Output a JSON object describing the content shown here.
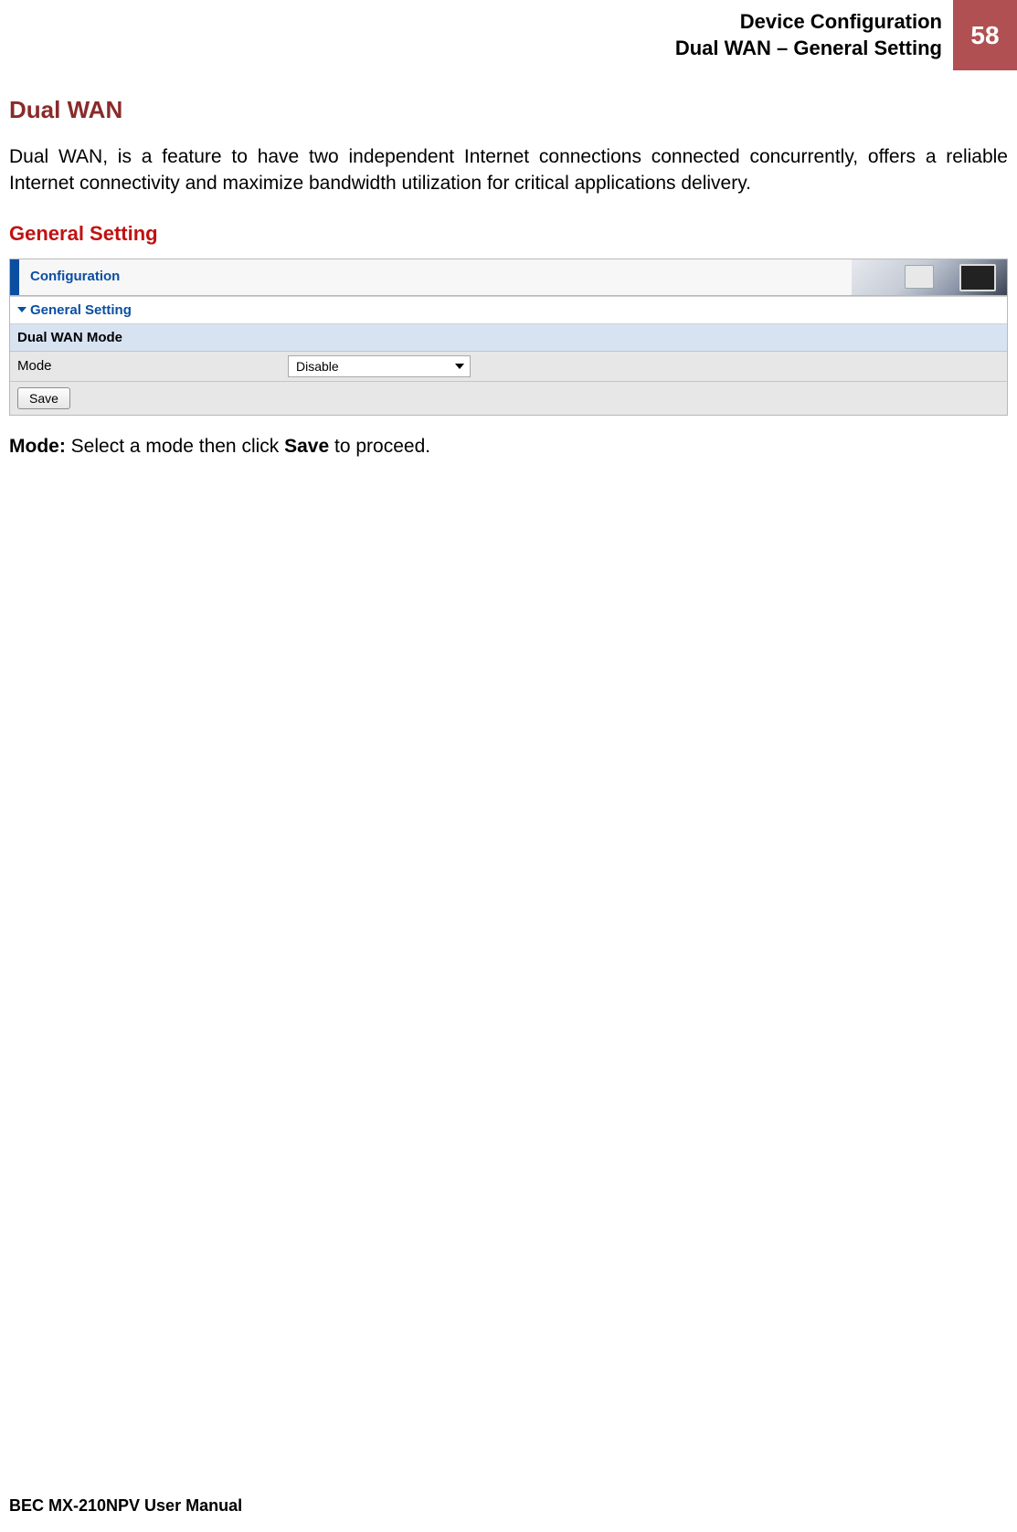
{
  "header": {
    "title_line1": "Device Configuration",
    "title_line2": "Dual WAN – General Setting",
    "page_number": "58"
  },
  "section": {
    "title": "Dual WAN",
    "intro": "Dual WAN, is a feature to have two independent Internet connections connected concurrently, offers a reliable Internet connectivity and maximize bandwidth utilization for critical applications delivery.",
    "subsection_title": "General Setting"
  },
  "panel": {
    "title": "Configuration",
    "section_header": "General Setting",
    "dual_wan_mode_label": "Dual WAN Mode",
    "mode_label": "Mode",
    "mode_selected": "Disable",
    "save_label": "Save"
  },
  "description": {
    "mode_bold": "Mode:",
    "mode_text_1": " Select a mode then click ",
    "mode_bold2": "Save",
    "mode_text_2": " to proceed."
  },
  "footer": {
    "text": "BEC MX-210NPV User Manual"
  }
}
